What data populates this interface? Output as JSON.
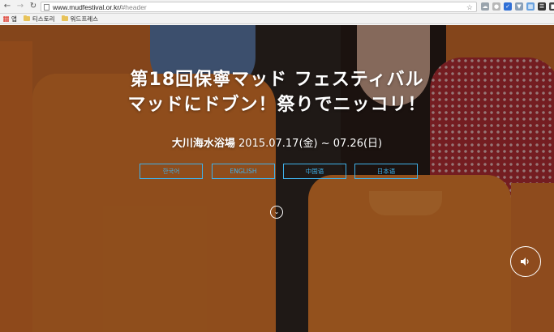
{
  "browser": {
    "url_host": "www.mudfestival.or.kr/",
    "url_hash": "#header",
    "bookmarks": [
      {
        "label": "앱",
        "icon": "apps-grid-icon"
      },
      {
        "label": "티스토리",
        "icon": "folder-icon"
      },
      {
        "label": "워드프레스",
        "icon": "folder-icon"
      }
    ]
  },
  "hero": {
    "title_line1": "第18回保寧マッド フェスティバル",
    "title_line2": "マッドにドブン！祭りでニッコリ！",
    "venue": "大川海水浴場",
    "dates": " 2015.07.17(金) ~ 07.26(日)",
    "languages": [
      "한국어",
      "ENGLISH",
      "中国语",
      "日本语"
    ],
    "scroll_icon": "chevron-down-circle-icon",
    "sound_icon": "volume-icon"
  },
  "colors": {
    "accent": "#3fb1ea",
    "shirt_orange": "#df7b2d"
  }
}
